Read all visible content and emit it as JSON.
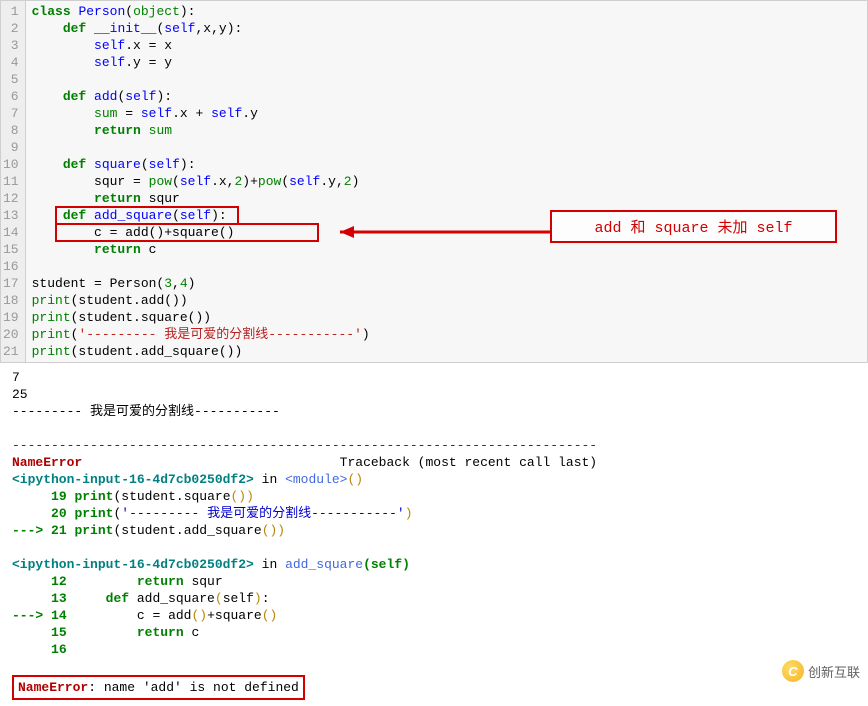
{
  "code": {
    "lines": [
      {
        "n": 1,
        "html": "<span class='kw'>class</span> <span class='ns'>Person</span>(<span class='bi'>object</span>):"
      },
      {
        "n": 2,
        "html": "    <span class='kw'>def</span> <span class='ns'>__init__</span>(<span class='ns'>self</span>,x,y):"
      },
      {
        "n": 3,
        "html": "        <span class='ns'>self</span>.x = x"
      },
      {
        "n": 4,
        "html": "        <span class='ns'>self</span>.y = y"
      },
      {
        "n": 5,
        "html": ""
      },
      {
        "n": 6,
        "html": "    <span class='kw'>def</span> <span class='ns'>add</span>(<span class='ns'>self</span>):"
      },
      {
        "n": 7,
        "html": "        <span class='bi'>sum</span> = <span class='ns'>self</span>.x + <span class='ns'>self</span>.y"
      },
      {
        "n": 8,
        "html": "        <span class='kw'>return</span> <span class='bi'>sum</span>"
      },
      {
        "n": 9,
        "html": ""
      },
      {
        "n": 10,
        "html": "    <span class='kw'>def</span> <span class='ns'>square</span>(<span class='ns'>self</span>):"
      },
      {
        "n": 11,
        "html": "        squr = <span class='bi'>pow</span>(<span class='ns'>self</span>.x,<span class='num'>2</span>)+<span class='bi'>pow</span>(<span class='ns'>self</span>.y,<span class='num'>2</span>)"
      },
      {
        "n": 12,
        "html": "        <span class='kw'>return</span> squr"
      },
      {
        "n": 13,
        "html": "    <span class='kw'>def</span> <span class='ns'>add_square</span>(<span class='ns'>self</span>):"
      },
      {
        "n": 14,
        "html": "        c = add()+square()"
      },
      {
        "n": 15,
        "html": "        <span class='kw'>return</span> c"
      },
      {
        "n": 16,
        "html": ""
      },
      {
        "n": 17,
        "html": "student = Person(<span class='num'>3</span>,<span class='num'>4</span>)"
      },
      {
        "n": 18,
        "html": "<span class='bi'>print</span>(student.add())"
      },
      {
        "n": 19,
        "html": "<span class='bi'>print</span>(student.square())"
      },
      {
        "n": 20,
        "html": "<span class='bi'>print</span>(<span class='str'>'--------- 我是可爱的分割线-----------'</span>)"
      },
      {
        "n": 21,
        "html": "<span class='bi'>print</span>(student.add_square())"
      }
    ]
  },
  "annotation": {
    "text": "add 和 square 未加 self"
  },
  "output": {
    "plain": [
      "7",
      "25",
      "--------- 我是可爱的分割线-----------"
    ],
    "dashline": "---------------------------------------------------------------------------",
    "err_name": "NameError",
    "traceback_label": "Traceback (most recent call last)",
    "file1": "<ipython-input-16-4d7cb0250df2>",
    "in_label": " in ",
    "module_label": "<module>",
    "paren": "()",
    "tb1": [
      {
        "n": "19",
        "arrow": "     ",
        "code": "<span class='kw'>print</span><span class='pun'>(</span>student<span class='pun'>.</span>square<span class='py-yellow'>())</span>"
      },
      {
        "n": "20",
        "arrow": "     ",
        "code": "<span class='kw'>print</span><span class='pun'>(</span><span class='py-blue'>'--------- 我是可爱的分割线-----------'</span><span class='py-yellow'>)</span>"
      },
      {
        "n": "21",
        "arrow": "---> ",
        "code": "<span class='kw'>print</span><span class='pun'>(</span>student<span class='pun'>.</span>add_square<span class='py-yellow'>())</span>"
      }
    ],
    "func_label": "add_square",
    "self_label": "(self)",
    "tb2": [
      {
        "n": "12",
        "arrow": "     ",
        "code": "        <span class='kw'>return</span> squr"
      },
      {
        "n": "13",
        "arrow": "     ",
        "code": "    <span class='kw'>def</span> add_square<span class='py-yellow'>(</span>self<span class='py-yellow'>)</span><span class='pun'>:</span>"
      },
      {
        "n": "14",
        "arrow": "---> ",
        "code": "        c <span class='pun'>=</span> add<span class='py-yellow'>()</span><span class='pun'>+</span>square<span class='py-yellow'>()</span>"
      },
      {
        "n": "15",
        "arrow": "     ",
        "code": "        <span class='kw'>return</span> c"
      },
      {
        "n": "16",
        "arrow": "     ",
        "code": ""
      }
    ],
    "final_error": "NameError",
    "final_msg": ": name 'add' is not defined"
  },
  "logo": {
    "letter": "C",
    "text": "创新互联"
  }
}
